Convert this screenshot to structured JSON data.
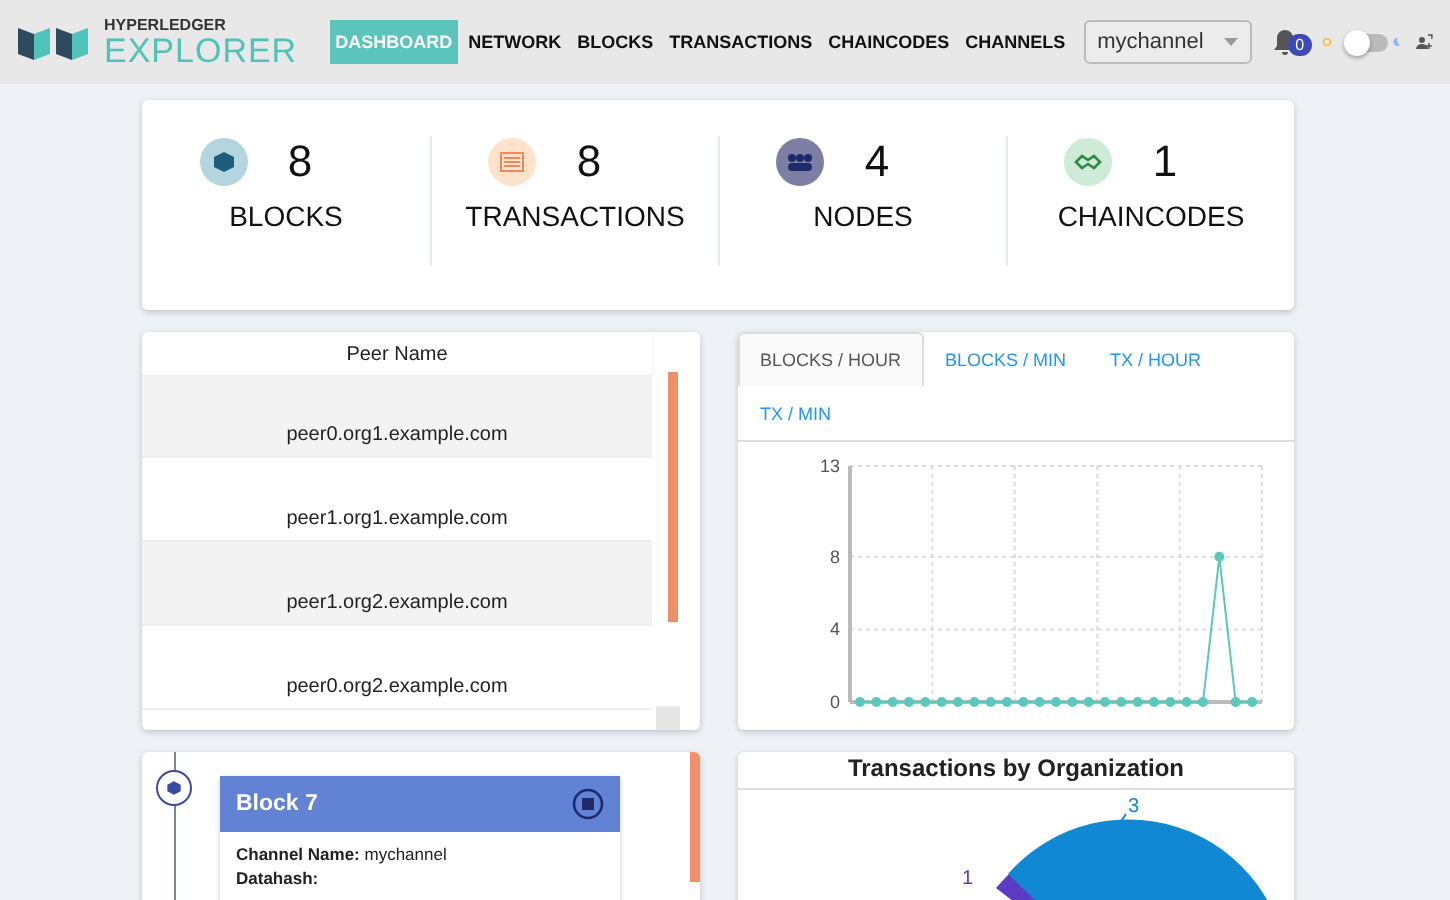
{
  "header": {
    "logo_top": "HYPERLEDGER",
    "logo_bottom": "EXPLORER",
    "nav": [
      {
        "label": "DASHBOARD",
        "selected": true
      },
      {
        "label": "NETWORK",
        "selected": false
      },
      {
        "label": "BLOCKS",
        "selected": false
      },
      {
        "label": "TRANSACTIONS",
        "selected": false
      },
      {
        "label": "CHAINCODES",
        "selected": false
      },
      {
        "label": "CHANNELS",
        "selected": false
      }
    ],
    "channel_select": {
      "value": "mychannel"
    },
    "notifications": {
      "count": "0"
    },
    "theme_toggle": {
      "on": false
    }
  },
  "stats": [
    {
      "kind": "blocks",
      "value": "8",
      "label": "BLOCKS"
    },
    {
      "kind": "transactions",
      "value": "8",
      "label": "TRANSACTIONS"
    },
    {
      "kind": "nodes",
      "value": "4",
      "label": "NODES"
    },
    {
      "kind": "chaincodes",
      "value": "1",
      "label": "CHAINCODES"
    }
  ],
  "peers": {
    "column": "Peer Name",
    "rows": [
      "peer0.org1.example.com",
      "peer1.org1.example.com",
      "peer1.org2.example.com",
      "peer0.org2.example.com"
    ]
  },
  "chart_panel": {
    "tabs": [
      {
        "label": "BLOCKS / HOUR",
        "selected": true
      },
      {
        "label": "BLOCKS / MIN",
        "selected": false
      },
      {
        "label": "TX / HOUR",
        "selected": false
      },
      {
        "label": "TX / MIN",
        "selected": false
      }
    ],
    "chart_data": {
      "type": "line",
      "ylim": [
        0,
        13
      ],
      "yticks": [
        0,
        4,
        8,
        13
      ],
      "series": [
        {
          "color": "#5bc8bc",
          "marker": "circle",
          "values": [
            0,
            0,
            0,
            0,
            0,
            0,
            0,
            0,
            0,
            0,
            0,
            0,
            0,
            0,
            0,
            0,
            0,
            0,
            0,
            0,
            0,
            0,
            8,
            0,
            0
          ]
        }
      ]
    }
  },
  "block_card": {
    "title": "Block 7",
    "channel": "**Channel Name:** mychannel",
    "datahash_label": "Datahash:"
  },
  "org_chart": {
    "title": "Transactions by Organization",
    "labels": [
      "3",
      "1"
    ]
  }
}
